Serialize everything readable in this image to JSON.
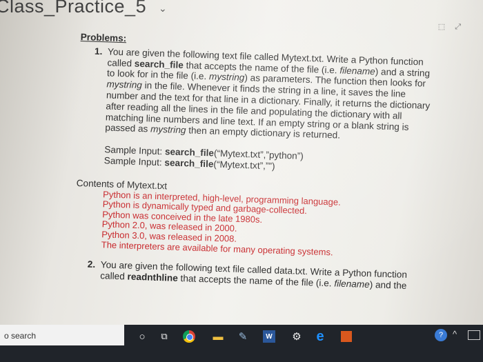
{
  "window": {
    "title": "Class_Practice_5",
    "chevron": "⌄",
    "icons": [
      "⬚",
      "⤢"
    ]
  },
  "doc": {
    "heading": "Problems:",
    "q1": {
      "number": "1.",
      "t1": "You are given the following text file called Mytext.txt. Write a Python function called ",
      "b1": "search_file",
      "t2": " that accepts the name of the file (i.e. ",
      "i1": "filename",
      "t3": ") and a string to look for in the file (i.e. ",
      "i2": "mystring",
      "t4": ") as parameters. The function then looks for ",
      "i3": "mystring",
      "t5": " in the file. Whenever it finds the string in a line, it saves the line number and the text for that line in a dictionary. Finally, it returns the dictionary after reading all the lines in the file and populating the dictionary with all matching line numbers and line text. If an empty string or a blank string is passed as ",
      "i4": "mystring",
      "t6": " then an empty dictionary is returned."
    },
    "samples": [
      {
        "prefix": "Sample Input: ",
        "call": "search_file",
        "args": "(“Mytext.txt”,”python”)"
      },
      {
        "prefix": "Sample Input: ",
        "call": "search_file",
        "args": "(“Mytext.txt”,””)"
      }
    ],
    "contents_label": "Contents of Mytext.txt",
    "contents_lines": [
      "Python is an interpreted, high-level, programming language.",
      "Python is dynamically typed and garbage-collected.",
      "Python was conceived in the late 1980s.",
      "Python 2.0, was released in 2000.",
      "Python 3.0, was released in 2008.",
      "The interpreters are available for many operating systems."
    ],
    "q2": {
      "number": "2.",
      "t1": "You are given the following text file called data.txt. Write a Python function called ",
      "b1": "readnthline",
      "t2": " that accepts the name of the file (i.e. ",
      "i1": "filename",
      "t3": ") and the"
    }
  },
  "taskbar": {
    "search_label": "o search",
    "icons": {
      "cortana": "○",
      "taskview": "⧉",
      "files": "▬",
      "paint": "✎",
      "word": "W",
      "settings": "⚙",
      "edge": "e",
      "help": "?",
      "tray_up": "^"
    }
  }
}
